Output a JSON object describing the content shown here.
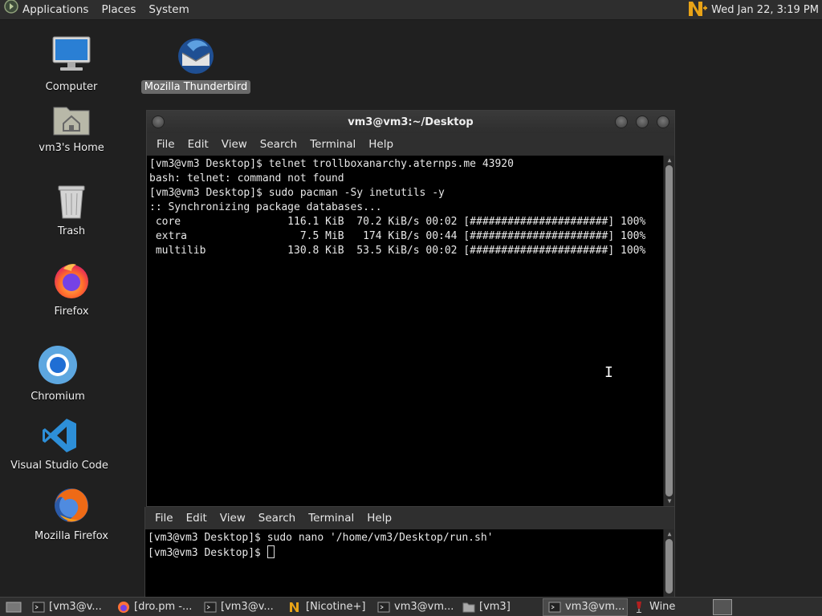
{
  "top_panel": {
    "menus": [
      "Applications",
      "Places",
      "System"
    ],
    "clock": "Wed Jan 22,  3:19 PM"
  },
  "desktop_icons": [
    {
      "label": "Computer",
      "icon": "computer-icon"
    },
    {
      "label": "vm3's Home",
      "icon": "home-folder-icon"
    },
    {
      "label": "Trash",
      "icon": "trash-icon"
    },
    {
      "label": "Firefox",
      "icon": "firefox-icon"
    },
    {
      "label": "Chromium",
      "icon": "chromium-icon"
    },
    {
      "label": "Visual Studio Code",
      "icon": "vscode-icon"
    },
    {
      "label": "Mozilla Firefox",
      "icon": "mozilla-firefox-icon"
    },
    {
      "label": "Mozilla Thunderbird",
      "icon": "thunderbird-icon",
      "selected": true
    }
  ],
  "terminal_main": {
    "title": "vm3@vm3:~/Desktop",
    "menu": [
      "File",
      "Edit",
      "View",
      "Search",
      "Terminal",
      "Help"
    ],
    "lines": [
      "[vm3@vm3 Desktop]$ telnet trollboxanarchy.aternps.me 43920",
      "bash: telnet: command not found",
      "[vm3@vm3 Desktop]$ sudo pacman -Sy inetutils -y",
      ":: Synchronizing package databases...",
      " core                 116.1 KiB  70.2 KiB/s 00:02 [######################] 100%",
      " extra                  7.5 MiB   174 KiB/s 00:44 [######################] 100%",
      " multilib             130.8 KiB  53.5 KiB/s 00:02 [######################] 100%"
    ]
  },
  "terminal_second": {
    "menu": [
      "File",
      "Edit",
      "View",
      "Search",
      "Terminal",
      "Help"
    ],
    "lines": [
      "[vm3@vm3 Desktop]$ sudo nano '/home/vm3/Desktop/run.sh'",
      "[vm3@vm3 Desktop]$ "
    ]
  },
  "taskbar": {
    "items": [
      {
        "label": "[vm3@v...",
        "icon": "terminal-icon"
      },
      {
        "label": "[dro.pm -...",
        "icon": "firefox-icon"
      },
      {
        "label": "[vm3@v...",
        "icon": "terminal-icon"
      },
      {
        "label": "[Nicotine+]",
        "icon": "nicotine-icon"
      },
      {
        "label": "vm3@vm...",
        "icon": "terminal-icon"
      },
      {
        "label": "[vm3]",
        "icon": "folder-icon"
      },
      {
        "label": "vm3@vm...",
        "icon": "terminal-icon",
        "active": true
      },
      {
        "label": "Wine",
        "icon": "wine-icon"
      }
    ]
  },
  "colors": {
    "desktop_bg": "#202020",
    "panel_bg": "#2e2e2e",
    "terminal_bg": "#000000",
    "nicotine_yellow": "#e8a317",
    "selection": "#6a6a6a"
  }
}
